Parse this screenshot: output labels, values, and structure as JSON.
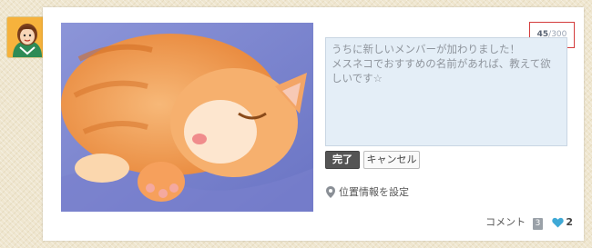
{
  "post": {
    "char_counter": {
      "current": "45",
      "max": "/300"
    },
    "textarea_value": "うちに新しいメンバーが加わりました！\nメスネコでおすすめの名前があれば、教えて欲しいです☆",
    "done_label": "完了",
    "cancel_label": "キャンセル",
    "location_label": "位置情報を設定",
    "comment_label": "コメント",
    "comment_count": "3",
    "like_count": "2"
  },
  "icons": {
    "avatar": "avatar-icon",
    "location": "map-pin-icon",
    "like": "heart-icon"
  },
  "colors": {
    "counter_border": "#d43c3c",
    "textarea_bg": "#e4eef7",
    "done_button": "#555555",
    "heart": "#3fa9d6"
  }
}
